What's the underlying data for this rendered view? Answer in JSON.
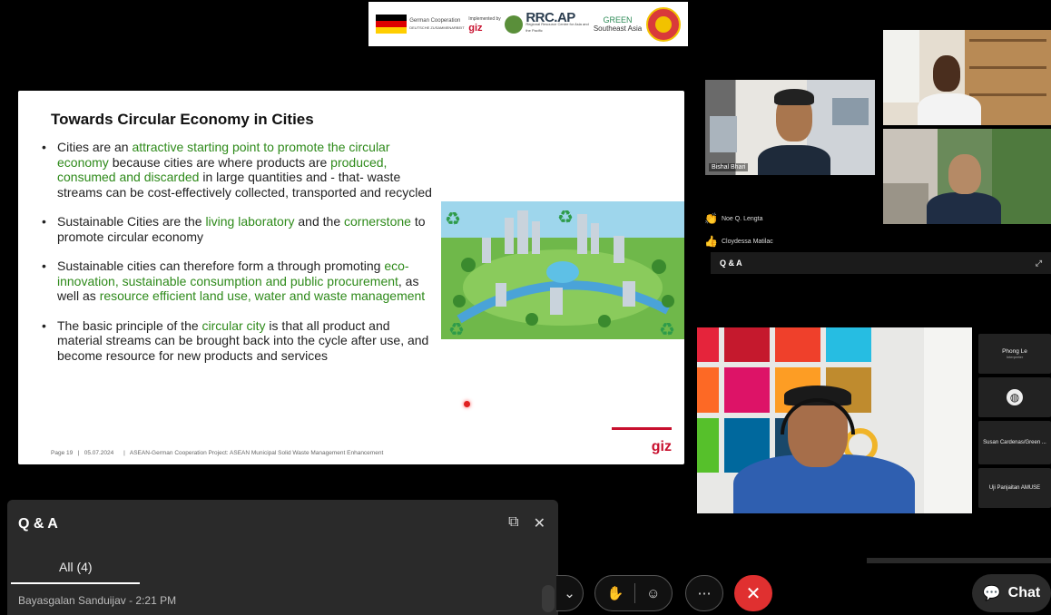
{
  "banner": {
    "logos": {
      "german": "German Cooperation",
      "german_sub": "DEUTSCHE ZUSAMMENARBEIT",
      "giz_label": "Implemented by",
      "rrc": "RRC.AP",
      "rrc_sub": "Regional Resource Centre for Asia and the Pacific",
      "green": "GREEN",
      "green_sub": "Southeast Asia"
    }
  },
  "slide": {
    "title": "Towards Circular Economy in Cities",
    "bullets": [
      {
        "parts": [
          {
            "t": "Cities are an ",
            "g": false
          },
          {
            "t": "attractive starting point to promote the circular economy",
            "g": true
          },
          {
            "t": " because cities are where products are ",
            "g": false
          },
          {
            "t": "produced, consumed and discarded",
            "g": true
          },
          {
            "t": " in large quantities and - that- waste streams can be cost-effectively collected, transported and recycled",
            "g": false
          }
        ]
      },
      {
        "parts": [
          {
            "t": "Sustainable Cities are the ",
            "g": false
          },
          {
            "t": "living laboratory",
            "g": true
          },
          {
            "t": " and the ",
            "g": false
          },
          {
            "t": "cornerstone",
            "g": true
          },
          {
            "t": " to promote circular economy",
            "g": false
          }
        ]
      },
      {
        "parts": [
          {
            "t": "Sustainable cities can therefore form a through promoting ",
            "g": false
          },
          {
            "t": "eco-innovation, sustainable consumption and public procurement",
            "g": true
          },
          {
            "t": ", as well as ",
            "g": false
          },
          {
            "t": "resource efficient land use, water and waste management",
            "g": true
          }
        ]
      },
      {
        "parts": [
          {
            "t": "The basic principle of the ",
            "g": false
          },
          {
            "t": "circular city",
            "g": true
          },
          {
            "t": " is that all product and material streams can be brought back into the cycle after use, and become resource for new products and services",
            "g": false
          }
        ]
      }
    ],
    "footer": "Page 19   |   05.07.2024      |   ASEAN-German Cooperation Project: ASEAN Municipal Solid Waste Management Enhancement",
    "brand": "giz"
  },
  "participants": {
    "tile1_name": "Bishal Bhari",
    "reactions": [
      {
        "emoji": "👏",
        "name": "Noe Q. Lengta"
      },
      {
        "emoji": "👍",
        "name": "Cloydessa Matilac"
      }
    ],
    "qa_bar_label": "Q & A",
    "side_list": [
      {
        "name": "Phong Le",
        "sub": "Interpreter"
      },
      {
        "name": "",
        "sub": ""
      },
      {
        "name": "Susan Cardenas/Green ...",
        "sub": ""
      },
      {
        "name": "Uji Panjaitan AMUSE",
        "sub": ""
      }
    ]
  },
  "qa_panel": {
    "title": "Q & A",
    "tab": "All (4)",
    "message": "Bayasgalan Sanduijav - 2:21 PM"
  },
  "controls": {
    "chat": "Chat"
  },
  "colors": {
    "accent_green": "#2e8a1a",
    "giz_red": "#c8102e",
    "leave_red": "#e03030"
  }
}
